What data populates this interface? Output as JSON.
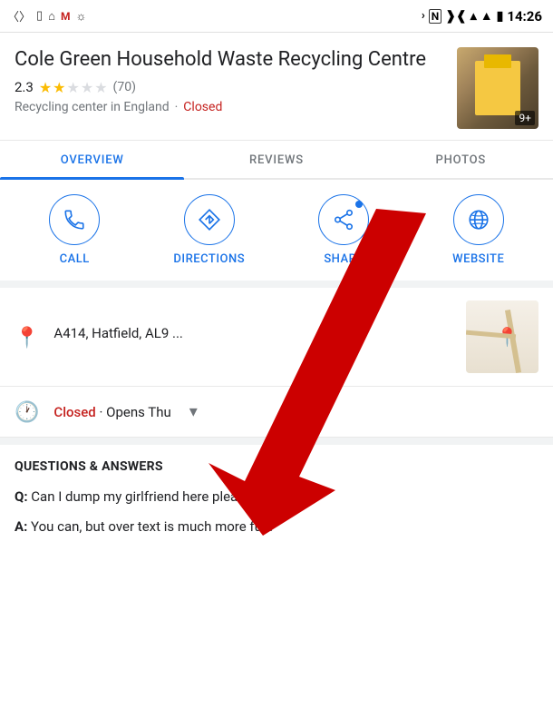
{
  "statusBar": {
    "time": "14:26",
    "icons": [
      "bluetooth",
      "nfc",
      "vibrate",
      "wifi",
      "signal",
      "battery"
    ]
  },
  "business": {
    "name": "Cole Green Household Waste Recycling Centre",
    "rating": "2.3",
    "reviewCount": "(70)",
    "type": "Recycling center in England",
    "status": "Closed",
    "imageCount": "9+"
  },
  "tabs": [
    {
      "label": "OVERVIEW",
      "active": true
    },
    {
      "label": "REVIEWS",
      "active": false
    },
    {
      "label": "PHOTOS",
      "active": false
    }
  ],
  "actions": [
    {
      "id": "call",
      "label": "CALL",
      "icon": "phone"
    },
    {
      "id": "directions",
      "label": "DIRECTIONS",
      "icon": "directions"
    },
    {
      "id": "share",
      "label": "SHARE",
      "icon": "share"
    },
    {
      "id": "website",
      "label": "WEBSITE",
      "icon": "website"
    }
  ],
  "info": {
    "address": "A414, Hatfield, AL9 ...",
    "hours": {
      "status": "Closed",
      "open_info": "Opens Thu"
    }
  },
  "qa": {
    "title": "QUESTIONS & ANSWERS",
    "items": [
      {
        "question": "Can I dump my girlfriend here please?",
        "answer": "You can, but over text is much more fun."
      }
    ]
  }
}
